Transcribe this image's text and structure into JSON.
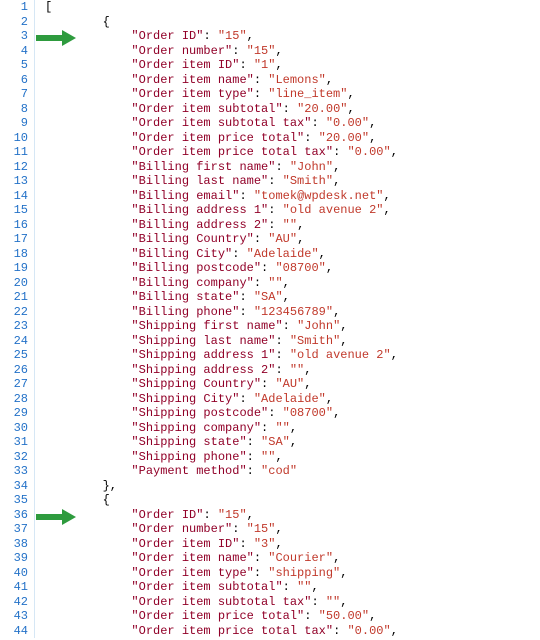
{
  "lines": [
    {
      "n": 1,
      "indent": 0,
      "tokens": [
        {
          "t": "punct",
          "v": "["
        }
      ]
    },
    {
      "n": 2,
      "indent": 2,
      "tokens": [
        {
          "t": "punct",
          "v": "{"
        }
      ]
    },
    {
      "n": 3,
      "indent": 3,
      "tokens": [
        {
          "t": "key",
          "v": "\"Order ID\""
        },
        {
          "t": "colon",
          "v": ": "
        },
        {
          "t": "str",
          "v": "\"15\""
        },
        {
          "t": "punct",
          "v": ","
        }
      ],
      "arrow": true
    },
    {
      "n": 4,
      "indent": 3,
      "tokens": [
        {
          "t": "key",
          "v": "\"Order number\""
        },
        {
          "t": "colon",
          "v": ": "
        },
        {
          "t": "str",
          "v": "\"15\""
        },
        {
          "t": "punct",
          "v": ","
        }
      ]
    },
    {
      "n": 5,
      "indent": 3,
      "tokens": [
        {
          "t": "key",
          "v": "\"Order item ID\""
        },
        {
          "t": "colon",
          "v": ": "
        },
        {
          "t": "str",
          "v": "\"1\""
        },
        {
          "t": "punct",
          "v": ","
        }
      ]
    },
    {
      "n": 6,
      "indent": 3,
      "tokens": [
        {
          "t": "key",
          "v": "\"Order item name\""
        },
        {
          "t": "colon",
          "v": ": "
        },
        {
          "t": "str",
          "v": "\"Lemons\""
        },
        {
          "t": "punct",
          "v": ","
        }
      ]
    },
    {
      "n": 7,
      "indent": 3,
      "tokens": [
        {
          "t": "key",
          "v": "\"Order item type\""
        },
        {
          "t": "colon",
          "v": ": "
        },
        {
          "t": "str",
          "v": "\"line_item\""
        },
        {
          "t": "punct",
          "v": ","
        }
      ]
    },
    {
      "n": 8,
      "indent": 3,
      "tokens": [
        {
          "t": "key",
          "v": "\"Order item subtotal\""
        },
        {
          "t": "colon",
          "v": ": "
        },
        {
          "t": "str",
          "v": "\"20.00\""
        },
        {
          "t": "punct",
          "v": ","
        }
      ]
    },
    {
      "n": 9,
      "indent": 3,
      "tokens": [
        {
          "t": "key",
          "v": "\"Order item subtotal tax\""
        },
        {
          "t": "colon",
          "v": ": "
        },
        {
          "t": "str",
          "v": "\"0.00\""
        },
        {
          "t": "punct",
          "v": ","
        }
      ]
    },
    {
      "n": 10,
      "indent": 3,
      "tokens": [
        {
          "t": "key",
          "v": "\"Order item price total\""
        },
        {
          "t": "colon",
          "v": ": "
        },
        {
          "t": "str",
          "v": "\"20.00\""
        },
        {
          "t": "punct",
          "v": ","
        }
      ]
    },
    {
      "n": 11,
      "indent": 3,
      "tokens": [
        {
          "t": "key",
          "v": "\"Order item price total tax\""
        },
        {
          "t": "colon",
          "v": ": "
        },
        {
          "t": "str",
          "v": "\"0.00\""
        },
        {
          "t": "punct",
          "v": ","
        }
      ]
    },
    {
      "n": 12,
      "indent": 3,
      "tokens": [
        {
          "t": "key",
          "v": "\"Billing first name\""
        },
        {
          "t": "colon",
          "v": ": "
        },
        {
          "t": "str",
          "v": "\"John\""
        },
        {
          "t": "punct",
          "v": ","
        }
      ]
    },
    {
      "n": 13,
      "indent": 3,
      "tokens": [
        {
          "t": "key",
          "v": "\"Billing last name\""
        },
        {
          "t": "colon",
          "v": ": "
        },
        {
          "t": "str",
          "v": "\"Smith\""
        },
        {
          "t": "punct",
          "v": ","
        }
      ]
    },
    {
      "n": 14,
      "indent": 3,
      "tokens": [
        {
          "t": "key",
          "v": "\"Billing email\""
        },
        {
          "t": "colon",
          "v": ": "
        },
        {
          "t": "str",
          "v": "\"tomek@wpdesk.net\""
        },
        {
          "t": "punct",
          "v": ","
        }
      ]
    },
    {
      "n": 15,
      "indent": 3,
      "tokens": [
        {
          "t": "key",
          "v": "\"Billing address 1\""
        },
        {
          "t": "colon",
          "v": ": "
        },
        {
          "t": "str",
          "v": "\"old avenue 2\""
        },
        {
          "t": "punct",
          "v": ","
        }
      ]
    },
    {
      "n": 16,
      "indent": 3,
      "tokens": [
        {
          "t": "key",
          "v": "\"Billing address 2\""
        },
        {
          "t": "colon",
          "v": ": "
        },
        {
          "t": "str",
          "v": "\"\""
        },
        {
          "t": "punct",
          "v": ","
        }
      ]
    },
    {
      "n": 17,
      "indent": 3,
      "tokens": [
        {
          "t": "key",
          "v": "\"Billing Country\""
        },
        {
          "t": "colon",
          "v": ": "
        },
        {
          "t": "str",
          "v": "\"AU\""
        },
        {
          "t": "punct",
          "v": ","
        }
      ]
    },
    {
      "n": 18,
      "indent": 3,
      "tokens": [
        {
          "t": "key",
          "v": "\"Billing City\""
        },
        {
          "t": "colon",
          "v": ": "
        },
        {
          "t": "str",
          "v": "\"Adelaide\""
        },
        {
          "t": "punct",
          "v": ","
        }
      ]
    },
    {
      "n": 19,
      "indent": 3,
      "tokens": [
        {
          "t": "key",
          "v": "\"Billing postcode\""
        },
        {
          "t": "colon",
          "v": ": "
        },
        {
          "t": "str",
          "v": "\"08700\""
        },
        {
          "t": "punct",
          "v": ","
        }
      ]
    },
    {
      "n": 20,
      "indent": 3,
      "tokens": [
        {
          "t": "key",
          "v": "\"Billing company\""
        },
        {
          "t": "colon",
          "v": ": "
        },
        {
          "t": "str",
          "v": "\"\""
        },
        {
          "t": "punct",
          "v": ","
        }
      ]
    },
    {
      "n": 21,
      "indent": 3,
      "tokens": [
        {
          "t": "key",
          "v": "\"Billing state\""
        },
        {
          "t": "colon",
          "v": ": "
        },
        {
          "t": "str",
          "v": "\"SA\""
        },
        {
          "t": "punct",
          "v": ","
        }
      ]
    },
    {
      "n": 22,
      "indent": 3,
      "tokens": [
        {
          "t": "key",
          "v": "\"Billing phone\""
        },
        {
          "t": "colon",
          "v": ": "
        },
        {
          "t": "str",
          "v": "\"123456789\""
        },
        {
          "t": "punct",
          "v": ","
        }
      ]
    },
    {
      "n": 23,
      "indent": 3,
      "tokens": [
        {
          "t": "key",
          "v": "\"Shipping first name\""
        },
        {
          "t": "colon",
          "v": ": "
        },
        {
          "t": "str",
          "v": "\"John\""
        },
        {
          "t": "punct",
          "v": ","
        }
      ]
    },
    {
      "n": 24,
      "indent": 3,
      "tokens": [
        {
          "t": "key",
          "v": "\"Shipping last name\""
        },
        {
          "t": "colon",
          "v": ": "
        },
        {
          "t": "str",
          "v": "\"Smith\""
        },
        {
          "t": "punct",
          "v": ","
        }
      ]
    },
    {
      "n": 25,
      "indent": 3,
      "tokens": [
        {
          "t": "key",
          "v": "\"Shipping address 1\""
        },
        {
          "t": "colon",
          "v": ": "
        },
        {
          "t": "str",
          "v": "\"old avenue 2\""
        },
        {
          "t": "punct",
          "v": ","
        }
      ]
    },
    {
      "n": 26,
      "indent": 3,
      "tokens": [
        {
          "t": "key",
          "v": "\"Shipping address 2\""
        },
        {
          "t": "colon",
          "v": ": "
        },
        {
          "t": "str",
          "v": "\"\""
        },
        {
          "t": "punct",
          "v": ","
        }
      ]
    },
    {
      "n": 27,
      "indent": 3,
      "tokens": [
        {
          "t": "key",
          "v": "\"Shipping Country\""
        },
        {
          "t": "colon",
          "v": ": "
        },
        {
          "t": "str",
          "v": "\"AU\""
        },
        {
          "t": "punct",
          "v": ","
        }
      ]
    },
    {
      "n": 28,
      "indent": 3,
      "tokens": [
        {
          "t": "key",
          "v": "\"Shipping City\""
        },
        {
          "t": "colon",
          "v": ": "
        },
        {
          "t": "str",
          "v": "\"Adelaide\""
        },
        {
          "t": "punct",
          "v": ","
        }
      ]
    },
    {
      "n": 29,
      "indent": 3,
      "tokens": [
        {
          "t": "key",
          "v": "\"Shipping postcode\""
        },
        {
          "t": "colon",
          "v": ": "
        },
        {
          "t": "str",
          "v": "\"08700\""
        },
        {
          "t": "punct",
          "v": ","
        }
      ]
    },
    {
      "n": 30,
      "indent": 3,
      "tokens": [
        {
          "t": "key",
          "v": "\"Shipping company\""
        },
        {
          "t": "colon",
          "v": ": "
        },
        {
          "t": "str",
          "v": "\"\""
        },
        {
          "t": "punct",
          "v": ","
        }
      ]
    },
    {
      "n": 31,
      "indent": 3,
      "tokens": [
        {
          "t": "key",
          "v": "\"Shipping state\""
        },
        {
          "t": "colon",
          "v": ": "
        },
        {
          "t": "str",
          "v": "\"SA\""
        },
        {
          "t": "punct",
          "v": ","
        }
      ]
    },
    {
      "n": 32,
      "indent": 3,
      "tokens": [
        {
          "t": "key",
          "v": "\"Shipping phone\""
        },
        {
          "t": "colon",
          "v": ": "
        },
        {
          "t": "str",
          "v": "\"\""
        },
        {
          "t": "punct",
          "v": ","
        }
      ]
    },
    {
      "n": 33,
      "indent": 3,
      "tokens": [
        {
          "t": "key",
          "v": "\"Payment method\""
        },
        {
          "t": "colon",
          "v": ": "
        },
        {
          "t": "str",
          "v": "\"cod\""
        }
      ]
    },
    {
      "n": 34,
      "indent": 2,
      "tokens": [
        {
          "t": "punct",
          "v": "},"
        }
      ]
    },
    {
      "n": 35,
      "indent": 2,
      "tokens": [
        {
          "t": "punct",
          "v": "{"
        }
      ]
    },
    {
      "n": 36,
      "indent": 3,
      "tokens": [
        {
          "t": "key",
          "v": "\"Order ID\""
        },
        {
          "t": "colon",
          "v": ": "
        },
        {
          "t": "str",
          "v": "\"15\""
        },
        {
          "t": "punct",
          "v": ","
        }
      ],
      "arrow": true
    },
    {
      "n": 37,
      "indent": 3,
      "tokens": [
        {
          "t": "key",
          "v": "\"Order number\""
        },
        {
          "t": "colon",
          "v": ": "
        },
        {
          "t": "str",
          "v": "\"15\""
        },
        {
          "t": "punct",
          "v": ","
        }
      ]
    },
    {
      "n": 38,
      "indent": 3,
      "tokens": [
        {
          "t": "key",
          "v": "\"Order item ID\""
        },
        {
          "t": "colon",
          "v": ": "
        },
        {
          "t": "str",
          "v": "\"3\""
        },
        {
          "t": "punct",
          "v": ","
        }
      ]
    },
    {
      "n": 39,
      "indent": 3,
      "tokens": [
        {
          "t": "key",
          "v": "\"Order item name\""
        },
        {
          "t": "colon",
          "v": ": "
        },
        {
          "t": "str",
          "v": "\"Courier\""
        },
        {
          "t": "punct",
          "v": ","
        }
      ]
    },
    {
      "n": 40,
      "indent": 3,
      "tokens": [
        {
          "t": "key",
          "v": "\"Order item type\""
        },
        {
          "t": "colon",
          "v": ": "
        },
        {
          "t": "str",
          "v": "\"shipping\""
        },
        {
          "t": "punct",
          "v": ","
        }
      ]
    },
    {
      "n": 41,
      "indent": 3,
      "tokens": [
        {
          "t": "key",
          "v": "\"Order item subtotal\""
        },
        {
          "t": "colon",
          "v": ": "
        },
        {
          "t": "str",
          "v": "\"\""
        },
        {
          "t": "punct",
          "v": ","
        }
      ]
    },
    {
      "n": 42,
      "indent": 3,
      "tokens": [
        {
          "t": "key",
          "v": "\"Order item subtotal tax\""
        },
        {
          "t": "colon",
          "v": ": "
        },
        {
          "t": "str",
          "v": "\"\""
        },
        {
          "t": "punct",
          "v": ","
        }
      ]
    },
    {
      "n": 43,
      "indent": 3,
      "tokens": [
        {
          "t": "key",
          "v": "\"Order item price total\""
        },
        {
          "t": "colon",
          "v": ": "
        },
        {
          "t": "str",
          "v": "\"50.00\""
        },
        {
          "t": "punct",
          "v": ","
        }
      ]
    },
    {
      "n": 44,
      "indent": 3,
      "tokens": [
        {
          "t": "key",
          "v": "\"Order item price total tax\""
        },
        {
          "t": "colon",
          "v": ": "
        },
        {
          "t": "str",
          "v": "\"0.00\""
        },
        {
          "t": "punct",
          "v": ","
        }
      ]
    }
  ],
  "indent_unit": "    "
}
